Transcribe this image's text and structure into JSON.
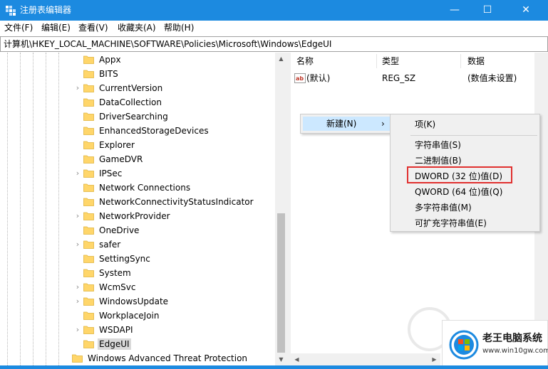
{
  "window": {
    "title": "注册表编辑器",
    "minimize": "—",
    "maximize": "☐",
    "close": "✕"
  },
  "menu": [
    "文件(F)",
    "编辑(E)",
    "查看(V)",
    "收藏夹(A)",
    "帮助(H)"
  ],
  "address": "计算机\\HKEY_LOCAL_MACHINE\\SOFTWARE\\Policies\\Microsoft\\Windows\\EdgeUI",
  "tree": [
    {
      "label": "Appx",
      "expandable": false
    },
    {
      "label": "BITS",
      "expandable": false
    },
    {
      "label": "CurrentVersion",
      "expandable": true
    },
    {
      "label": "DataCollection",
      "expandable": false
    },
    {
      "label": "DriverSearching",
      "expandable": false
    },
    {
      "label": "EnhancedStorageDevices",
      "expandable": false
    },
    {
      "label": "Explorer",
      "expandable": false
    },
    {
      "label": "GameDVR",
      "expandable": false
    },
    {
      "label": "IPSec",
      "expandable": true
    },
    {
      "label": "Network Connections",
      "expandable": false
    },
    {
      "label": "NetworkConnectivityStatusIndicator",
      "expandable": false
    },
    {
      "label": "NetworkProvider",
      "expandable": true
    },
    {
      "label": "OneDrive",
      "expandable": false
    },
    {
      "label": "safer",
      "expandable": true
    },
    {
      "label": "SettingSync",
      "expandable": false
    },
    {
      "label": "System",
      "expandable": false
    },
    {
      "label": "WcmSvc",
      "expandable": true
    },
    {
      "label": "WindowsUpdate",
      "expandable": true
    },
    {
      "label": "WorkplaceJoin",
      "expandable": false
    },
    {
      "label": "WSDAPI",
      "expandable": true
    },
    {
      "label": "EdgeUI",
      "expandable": false,
      "selected": true
    },
    {
      "label": "Windows Advanced Threat Protection",
      "expandable": false,
      "parent_level": true
    }
  ],
  "list": {
    "columns": [
      "名称",
      "类型",
      "数据"
    ],
    "rows": [
      {
        "name": "(默认)",
        "type": "REG_SZ",
        "data": "(数值未设置)",
        "icon": "string-value-icon"
      }
    ]
  },
  "context_menu": {
    "item": "新建(N)",
    "arrow": "›",
    "submenu": [
      "项(K)",
      "字符串值(S)",
      "二进制值(B)",
      "DWORD (32 位)值(D)",
      "QWORD (64 位)值(Q)",
      "多字符串值(M)",
      "可扩充字符串值(E)"
    ],
    "highlighted_index": 3,
    "highlight_color": "#e0302f"
  },
  "watermark": {
    "brand": "老王电脑系统",
    "site": "www.win10gw.com"
  },
  "colors": {
    "titlebar": "#1c8ae0",
    "menu_hover": "#cce8ff",
    "folder": "#ffd66a"
  }
}
